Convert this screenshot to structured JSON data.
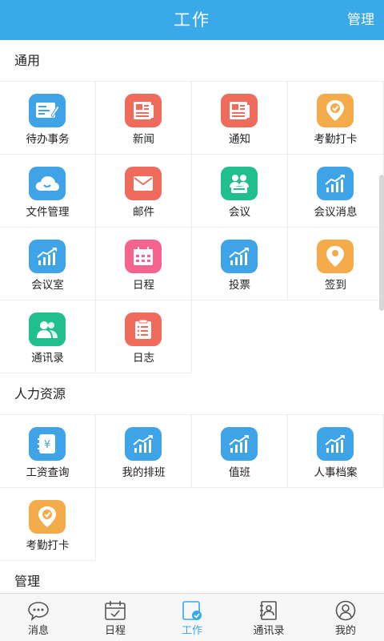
{
  "header": {
    "title": "工作",
    "manage_label": "管理"
  },
  "sections": [
    {
      "title": "通用",
      "items": [
        {
          "label": "待办事务",
          "icon": "todo-icon",
          "color": "blue"
        },
        {
          "label": "新闻",
          "icon": "newspaper-icon",
          "color": "red"
        },
        {
          "label": "通知",
          "icon": "notice-icon",
          "color": "red"
        },
        {
          "label": "考勤打卡",
          "icon": "clock-in-pin-icon",
          "color": "orange"
        },
        {
          "label": "文件管理",
          "icon": "cloud-icon",
          "color": "blue"
        },
        {
          "label": "邮件",
          "icon": "mail-icon",
          "color": "red"
        },
        {
          "label": "会议",
          "icon": "meeting-people-icon",
          "color": "green"
        },
        {
          "label": "会议消息",
          "icon": "chart-up-icon",
          "color": "blue"
        },
        {
          "label": "会议室",
          "icon": "chart-up-icon",
          "color": "blue"
        },
        {
          "label": "日程",
          "icon": "calendar-icon",
          "color": "pink"
        },
        {
          "label": "投票",
          "icon": "chart-up-icon",
          "color": "blue"
        },
        {
          "label": "签到",
          "icon": "location-pin-icon",
          "color": "orange"
        },
        {
          "label": "通讯录",
          "icon": "contacts-icon",
          "color": "green"
        },
        {
          "label": "日志",
          "icon": "log-clipboard-icon",
          "color": "red"
        }
      ]
    },
    {
      "title": "人力资源",
      "items": [
        {
          "label": "工资查询",
          "icon": "salary-icon",
          "color": "blue"
        },
        {
          "label": "我的排班",
          "icon": "chart-up-icon",
          "color": "blue"
        },
        {
          "label": "值班",
          "icon": "chart-up-icon",
          "color": "blue"
        },
        {
          "label": "人事档案",
          "icon": "chart-up-icon",
          "color": "blue"
        },
        {
          "label": "考勤打卡",
          "icon": "clock-in-pin-icon",
          "color": "orange"
        }
      ]
    },
    {
      "title": "管理",
      "items": []
    }
  ],
  "bottom_nav": [
    {
      "label": "消息",
      "icon": "chat-bubble-icon",
      "active": false
    },
    {
      "label": "日程",
      "icon": "calendar-check-icon",
      "active": false
    },
    {
      "label": "工作",
      "icon": "work-check-icon",
      "active": true
    },
    {
      "label": "通讯录",
      "icon": "address-book-icon",
      "active": false
    },
    {
      "label": "我的",
      "icon": "user-icon",
      "active": false
    }
  ],
  "colors": {
    "accent": "#3aa9ea",
    "blue": "#3fa3e8",
    "red": "#ef6b5b",
    "orange": "#f4ac4a",
    "green": "#22bf8e",
    "pink": "#f5648f"
  }
}
